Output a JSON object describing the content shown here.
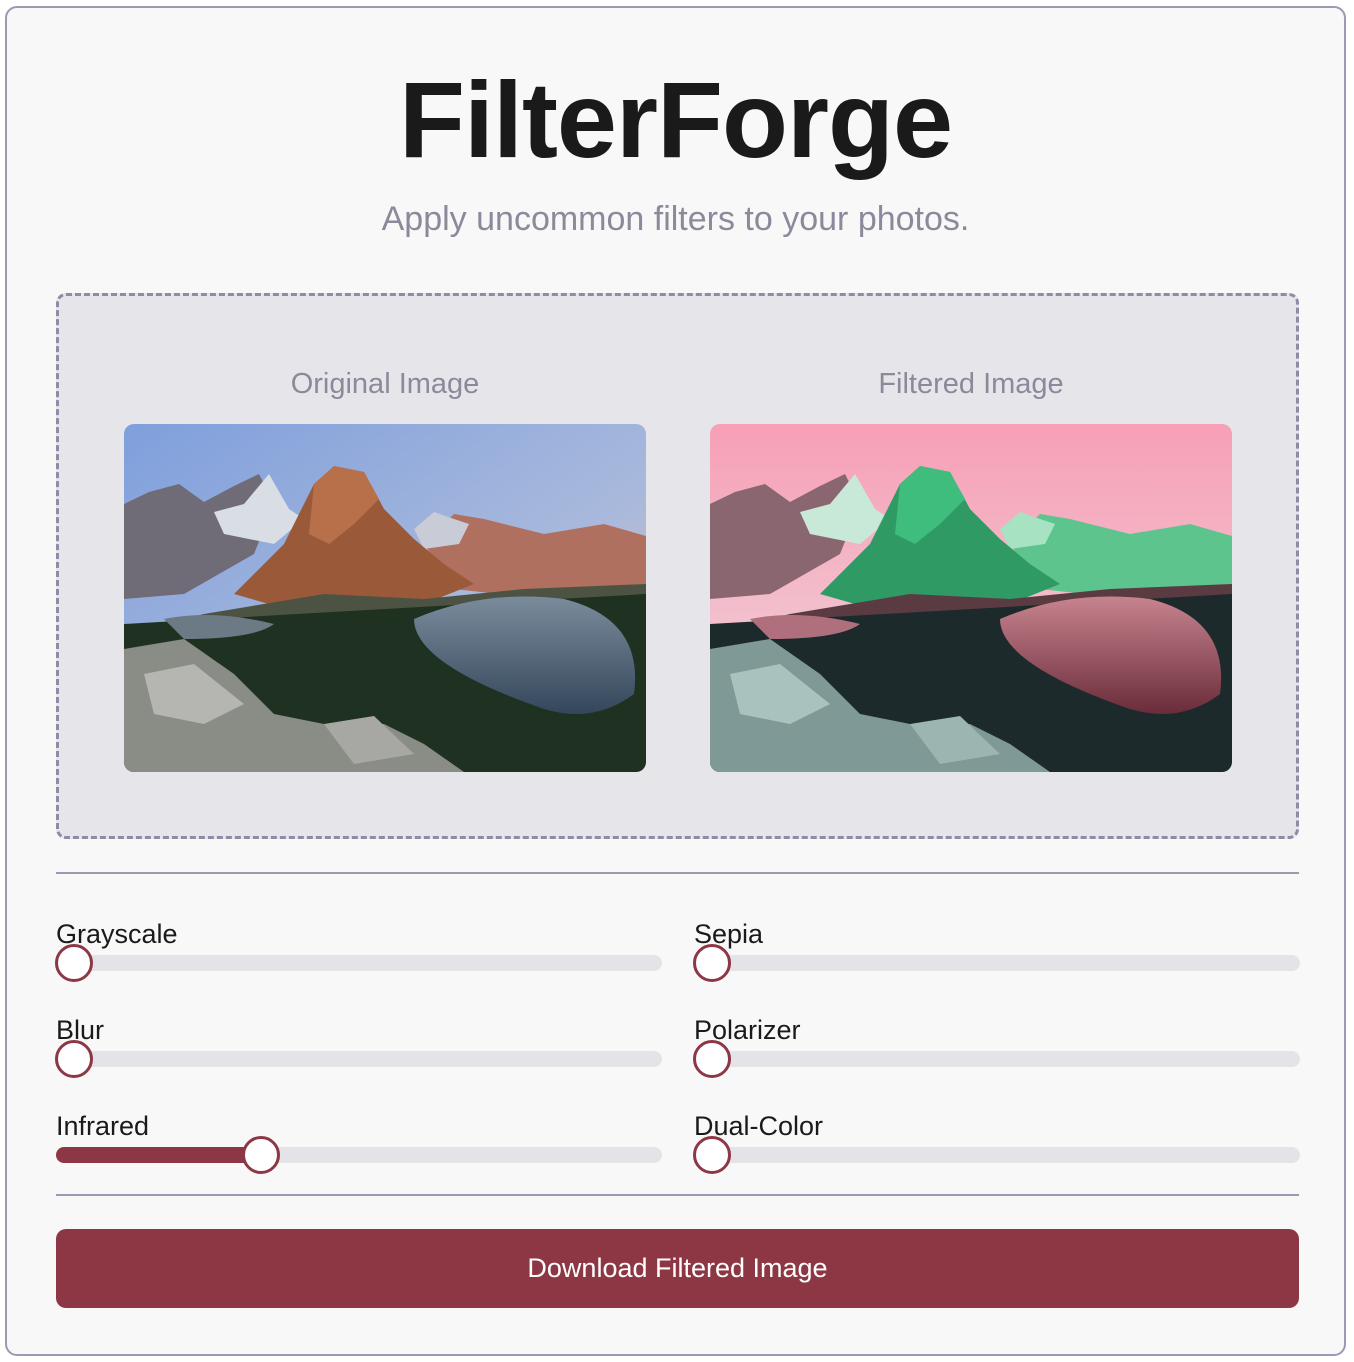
{
  "header": {
    "title": "FilterForge",
    "subtitle": "Apply uncommon filters to your photos."
  },
  "preview": {
    "original_label": "Original Image",
    "filtered_label": "Filtered Image"
  },
  "filters": [
    {
      "id": "grayscale",
      "label": "Grayscale",
      "value": 0
    },
    {
      "id": "sepia",
      "label": "Sepia",
      "value": 0
    },
    {
      "id": "blur",
      "label": "Blur",
      "value": 0
    },
    {
      "id": "polarizer",
      "label": "Polarizer",
      "value": 0
    },
    {
      "id": "infrared",
      "label": "Infrared",
      "value": 0.33
    },
    {
      "id": "dual-color",
      "label": "Dual-Color",
      "value": 0
    }
  ],
  "actions": {
    "download_label": "Download Filtered Image"
  },
  "colors": {
    "accent": "#8e3744",
    "track": "#e4e3e8",
    "border": "#9d98b3"
  }
}
